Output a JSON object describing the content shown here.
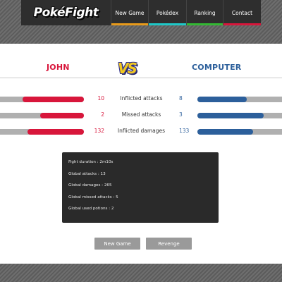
{
  "logo": {
    "text": "PokéFight"
  },
  "nav": {
    "items": [
      {
        "label": "New Game",
        "color": "#e89a1a"
      },
      {
        "label": "Pokédex",
        "color": "#1ec8c8"
      },
      {
        "label": "Ranking",
        "color": "#33b833"
      },
      {
        "label": "Contact",
        "color": "#d8163b"
      }
    ]
  },
  "versus": {
    "player1": "JOHN",
    "vs": "VS",
    "player2": "COMPUTER"
  },
  "stats": [
    {
      "label": "Inflicted attacks",
      "p1": "10",
      "p2": "8",
      "p1_fill": 0.73,
      "p2_fill": 0.58
    },
    {
      "label": "Missed attacks",
      "p1": "2",
      "p2": "3",
      "p1_fill": 0.52,
      "p2_fill": 0.78
    },
    {
      "label": "Inflicted damages",
      "p1": "132",
      "p2": "133",
      "p1_fill": 0.67,
      "p2_fill": 0.66
    }
  ],
  "summary": {
    "lines": [
      "Fight duration : 2m10s",
      "Global attacks : 13",
      "Global damages : 265",
      "Global missed attacks : 5",
      "Global used potions : 2"
    ]
  },
  "buttons": {
    "new_game": "New Game",
    "revenge": "Revenge"
  },
  "colors": {
    "player1": "#d8163b",
    "player2": "#2c5f9b"
  }
}
